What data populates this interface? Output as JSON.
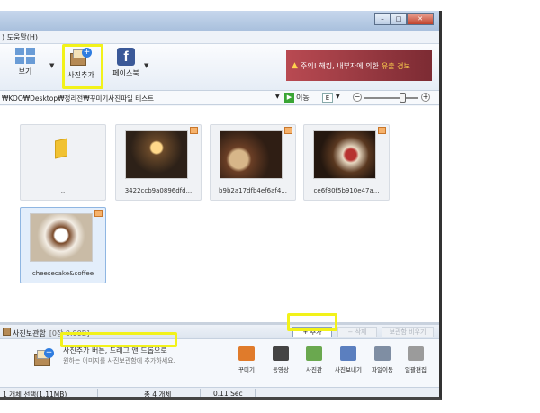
{
  "menu": {
    "help_partial": ") 도움말(H)"
  },
  "toolbar": {
    "view_label": "보기",
    "add_photo_label": "사진추가",
    "facebook_label": "페이스북",
    "alert_text": "주의! 해킹, 내부자에 의한",
    "alert_highlight": "유출 경보"
  },
  "address": {
    "path": "₩KOO₩Desktop₩정리전₩꾸미기사진파일 테스트",
    "go_label": "이동",
    "e_label": "E"
  },
  "zoom": {
    "level": 0.7
  },
  "thumbnails": [
    {
      "caption": "..",
      "kind": "folder"
    },
    {
      "caption": "3422ccb9a0896dfd...",
      "kind": "photo"
    },
    {
      "caption": "b9b2a17dfb4ef6af4...",
      "kind": "photo"
    },
    {
      "caption": "ce6f80f5b910e47a...",
      "kind": "photo"
    },
    {
      "caption": "cheesecake&coffee",
      "kind": "photo",
      "selected": true
    }
  ],
  "storage": {
    "title": "사진보관함",
    "count": "[0장 0.00B]",
    "add_label": "+ 추가",
    "delete_label": "− 삭제",
    "clear_label": "보관함 비우기",
    "hint_main": "사진추가 버튼, 드래그 앤 드롭",
    "hint_suffix": "으로",
    "hint_sub": "원하는 이미지를 사진보관함에 추가하세요."
  },
  "tools": [
    {
      "label": "꾸미기",
      "icon": "palette-icon",
      "color": "#e07b2b"
    },
    {
      "label": "동영상",
      "icon": "film-icon",
      "color": "#444444"
    },
    {
      "label": "사진관",
      "icon": "photo-studio-icon",
      "color": "#6aa84f"
    },
    {
      "label": "사진보내기",
      "icon": "send-photo-icon",
      "color": "#5b7fbf"
    },
    {
      "label": "파일이동",
      "icon": "move-file-icon",
      "color": "#7f8ea3"
    },
    {
      "label": "일괄편집",
      "icon": "batch-edit-icon",
      "color": "#9b9b9b"
    }
  ],
  "status": {
    "selection": "1 개체 선택(1.11MB)",
    "total": "총 4 개체",
    "time": "0.11 Sec"
  },
  "colors": {
    "highlight": "#f2f21a",
    "alert_bg": "#a03a44"
  }
}
